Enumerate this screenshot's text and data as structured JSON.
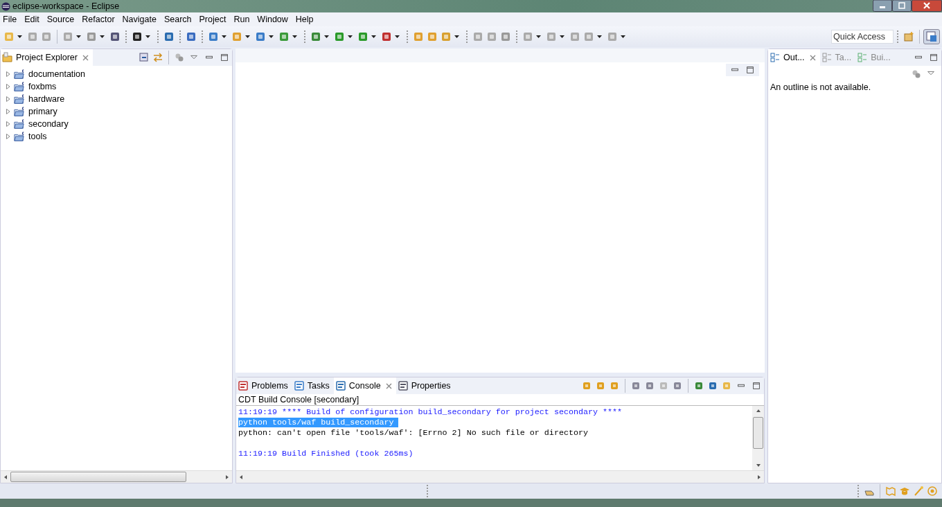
{
  "window": {
    "title": "eclipse-workspace - Eclipse"
  },
  "menu": [
    "File",
    "Edit",
    "Source",
    "Refactor",
    "Navigate",
    "Search",
    "Project",
    "Run",
    "Window",
    "Help"
  ],
  "quick_access": {
    "placeholder": "Quick Access"
  },
  "project_explorer": {
    "tab": {
      "label": "Project Explorer",
      "selected": true
    },
    "items": [
      {
        "label": "documentation",
        "expanded": false
      },
      {
        "label": "foxbms",
        "expanded": false
      },
      {
        "label": "hardware",
        "expanded": false
      },
      {
        "label": "primary",
        "expanded": false
      },
      {
        "label": "secondary",
        "expanded": false
      },
      {
        "label": "tools",
        "expanded": false
      }
    ]
  },
  "outline": {
    "tabs": [
      {
        "label": "Out...",
        "selected": true
      },
      {
        "label": "Ta...",
        "selected": false
      },
      {
        "label": "Bui...",
        "selected": false
      }
    ],
    "message": "An outline is not available."
  },
  "bottom": {
    "tabs": [
      {
        "label": "Problems",
        "selected": false
      },
      {
        "label": "Tasks",
        "selected": false
      },
      {
        "label": "Console",
        "selected": true
      },
      {
        "label": "Properties",
        "selected": false
      }
    ],
    "console_title": "CDT Build Console [secondary]",
    "lines": [
      {
        "kind": "info",
        "text": "11:19:19 **** Build of configuration build_secondary for project secondary ****",
        "selected": false
      },
      {
        "kind": "command",
        "text": "python tools/waf build_secondary ",
        "selected": true
      },
      {
        "kind": "output",
        "text": "python: can't open file 'tools/waf': [Errno 2] No such file or directory",
        "selected": false
      },
      {
        "kind": "blank",
        "selected": false
      },
      {
        "kind": "info",
        "text": "11:19:19 Build Finished (took 265ms)",
        "selected": false
      }
    ]
  }
}
